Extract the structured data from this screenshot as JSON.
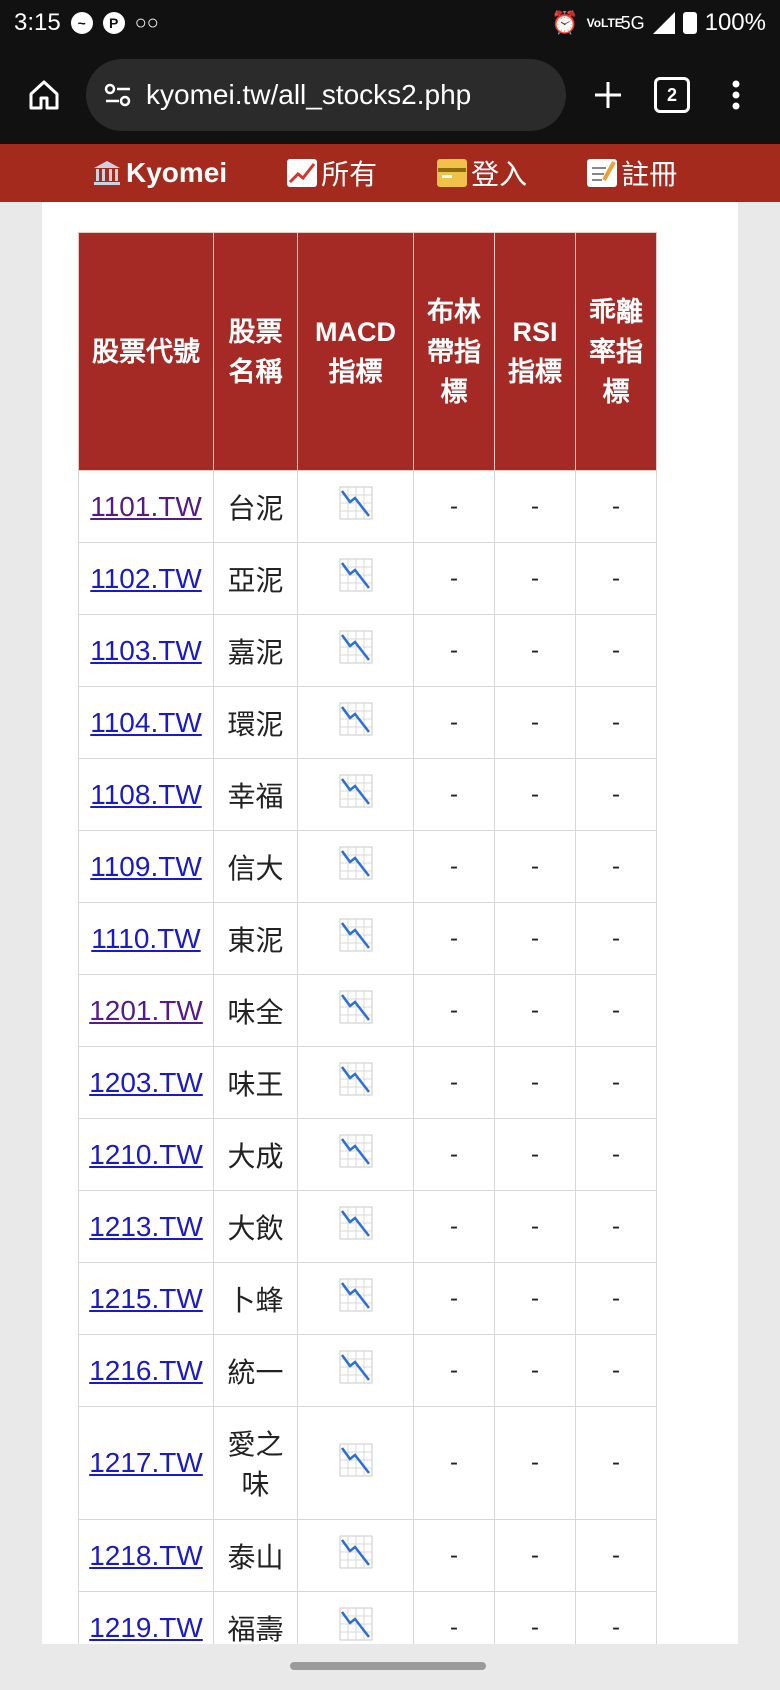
{
  "status_bar": {
    "time": "3:15",
    "network": "5G",
    "volte": "VoLTE",
    "battery": "100%"
  },
  "browser": {
    "url": "kyomei.tw/all_stocks2.php",
    "tab_count": "2"
  },
  "nav": {
    "brand": "Kyomei",
    "items": [
      {
        "label": "所有",
        "icon": "chart-up-icon"
      },
      {
        "label": "登入",
        "icon": "credit-card-icon"
      },
      {
        "label": "註冊",
        "icon": "memo-icon"
      }
    ]
  },
  "table": {
    "headers": [
      "股票代號",
      "股票名稱",
      "MACD指標",
      "布林帶指標",
      "RSI指標",
      "乖離率指標"
    ],
    "rows": [
      {
        "code": "1101.TW",
        "name": "台泥",
        "macd": "chart-down-icon",
        "bollinger": "-",
        "rsi": "-",
        "bias": "-",
        "visited": true
      },
      {
        "code": "1102.TW",
        "name": "亞泥",
        "macd": "chart-down-icon",
        "bollinger": "-",
        "rsi": "-",
        "bias": "-"
      },
      {
        "code": "1103.TW",
        "name": "嘉泥",
        "macd": "chart-down-icon",
        "bollinger": "-",
        "rsi": "-",
        "bias": "-"
      },
      {
        "code": "1104.TW",
        "name": "環泥",
        "macd": "chart-down-icon",
        "bollinger": "-",
        "rsi": "-",
        "bias": "-"
      },
      {
        "code": "1108.TW",
        "name": "幸福",
        "macd": "chart-down-icon",
        "bollinger": "-",
        "rsi": "-",
        "bias": "-"
      },
      {
        "code": "1109.TW",
        "name": "信大",
        "macd": "chart-down-icon",
        "bollinger": "-",
        "rsi": "-",
        "bias": "-"
      },
      {
        "code": "1110.TW",
        "name": "東泥",
        "macd": "chart-down-icon",
        "bollinger": "-",
        "rsi": "-",
        "bias": "-"
      },
      {
        "code": "1201.TW",
        "name": "味全",
        "macd": "chart-down-icon",
        "bollinger": "-",
        "rsi": "-",
        "bias": "-",
        "visited": true
      },
      {
        "code": "1203.TW",
        "name": "味王",
        "macd": "chart-down-icon",
        "bollinger": "-",
        "rsi": "-",
        "bias": "-"
      },
      {
        "code": "1210.TW",
        "name": "大成",
        "macd": "chart-down-icon",
        "bollinger": "-",
        "rsi": "-",
        "bias": "-"
      },
      {
        "code": "1213.TW",
        "name": "大飲",
        "macd": "chart-down-icon",
        "bollinger": "-",
        "rsi": "-",
        "bias": "-"
      },
      {
        "code": "1215.TW",
        "name": "卜蜂",
        "macd": "chart-down-icon",
        "bollinger": "-",
        "rsi": "-",
        "bias": "-"
      },
      {
        "code": "1216.TW",
        "name": "統一",
        "macd": "chart-down-icon",
        "bollinger": "-",
        "rsi": "-",
        "bias": "-"
      },
      {
        "code": "1217.TW",
        "name": "愛之味",
        "macd": "chart-down-icon",
        "bollinger": "-",
        "rsi": "-",
        "bias": "-"
      },
      {
        "code": "1218.TW",
        "name": "泰山",
        "macd": "chart-down-icon",
        "bollinger": "-",
        "rsi": "-",
        "bias": "-"
      },
      {
        "code": "1219.TW",
        "name": "福壽",
        "macd": "chart-down-icon",
        "bollinger": "-",
        "rsi": "-",
        "bias": "-"
      }
    ]
  },
  "colors": {
    "header_red": "#a52a26",
    "nav_red": "#a52a1e",
    "link_blue": "#1a1acd",
    "link_visited": "#551a8b"
  }
}
